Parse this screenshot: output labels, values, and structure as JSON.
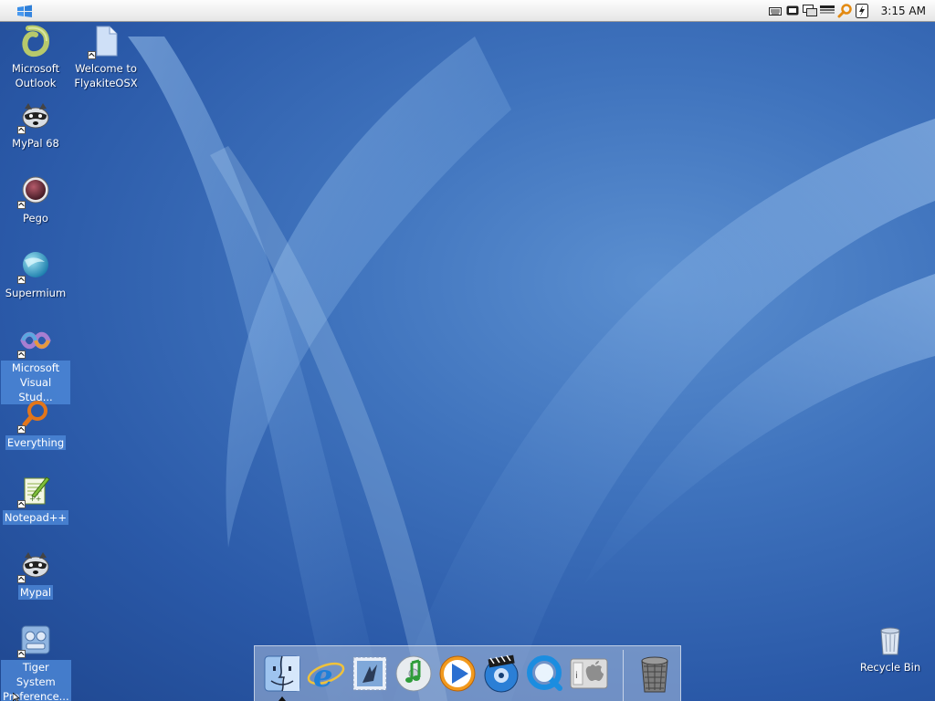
{
  "menubar": {
    "clock": "3:15 AM",
    "tray_icons": [
      "keyboard-icon",
      "display-icon",
      "network-icon",
      "volume-icon",
      "search-icon",
      "power-icon"
    ]
  },
  "desktop_icons": [
    {
      "id": "outlook",
      "label": "Microsoft Outlook",
      "icon": "outlook-icon",
      "selected": false
    },
    {
      "id": "welcome",
      "label": "Welcome to FlyakiteOSX",
      "icon": "document-icon",
      "selected": false
    },
    {
      "id": "mypal68",
      "label": "MyPal 68",
      "icon": "raccoon-icon",
      "selected": false
    },
    {
      "id": "pego",
      "label": "Pego",
      "icon": "pego-icon",
      "selected": false
    },
    {
      "id": "supermium",
      "label": "Supermium",
      "icon": "supermium-icon",
      "selected": false
    },
    {
      "id": "vstudio",
      "label": "Microsoft Visual Stud...",
      "icon": "visual-studio-icon",
      "selected": true
    },
    {
      "id": "everything",
      "label": "Everything",
      "icon": "everything-search-icon",
      "selected": true
    },
    {
      "id": "notepadpp",
      "label": "Notepad++",
      "icon": "notepad-plus-plus-icon",
      "selected": true
    },
    {
      "id": "mypal",
      "label": "Mypal",
      "icon": "raccoon-icon",
      "selected": true
    },
    {
      "id": "tiger",
      "label": "Tiger System Preference...",
      "icon": "system-preferences-icon",
      "selected": true
    },
    {
      "id": "recycle",
      "label": "Recycle Bin",
      "icon": "recycle-bin-icon",
      "selected": false
    }
  ],
  "dock": {
    "items": [
      "finder-icon",
      "internet-explorer-icon",
      "mail-icon",
      "itunes-icon",
      "media-player-icon",
      "dvd-player-icon",
      "quicktime-icon",
      "system-info-icon",
      "trash-icon"
    ]
  },
  "colors": {
    "desktop": "#3f73bd",
    "menubar": "#f0f0f0",
    "selection": "#508cdc"
  }
}
